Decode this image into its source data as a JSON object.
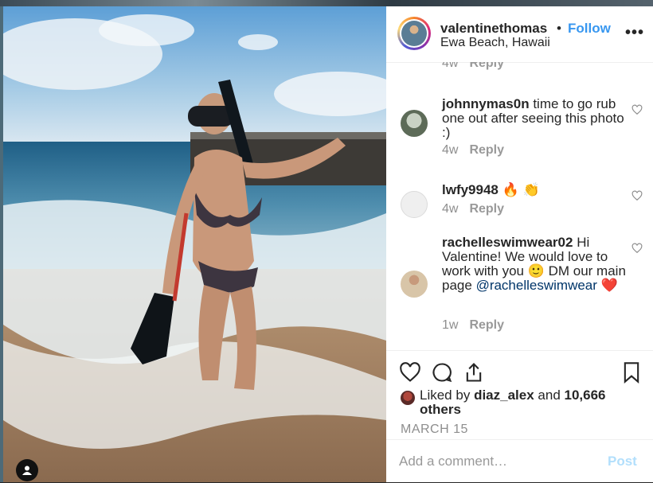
{
  "post": {
    "username": "valentinethomas",
    "separator": "•",
    "follow_label": "Follow",
    "location": "Ewa Beach, Hawaii",
    "more_label": "•••"
  },
  "comments": [
    {
      "user": "",
      "text": "",
      "when": "4w",
      "reply": "Reply"
    },
    {
      "user": "johnnymas0n",
      "text": "time to go rub one out after seeing this photo :)",
      "when": "4w",
      "reply": "Reply"
    },
    {
      "user": "lwfy9948",
      "text": "🔥 👏",
      "when": "4w",
      "reply": "Reply"
    },
    {
      "user": "rachelleswimwear02",
      "text": "Hi Valentine! We would love to work with you 🙂 DM our main page",
      "mention": "@rachelleswimwear",
      "emoji": "❤️",
      "when": "1w",
      "reply": "Reply"
    }
  ],
  "likes": {
    "prefix": "Liked by",
    "liker": "diaz_alex",
    "conjunction": "and",
    "others": "10,666 others"
  },
  "date": "MARCH 15",
  "comment_box": {
    "placeholder": "Add a comment…",
    "post_label": "Post"
  },
  "colors": {
    "follow": "#3897f0",
    "post_disabled": "#b2dffc",
    "mention": "#003569",
    "muted": "#8e8e8e"
  },
  "icons": {
    "like": "heart-icon",
    "comment": "comment-icon",
    "share": "share-icon",
    "save": "bookmark-icon",
    "more": "more-options-icon",
    "user_tag": "user-tag-icon"
  }
}
